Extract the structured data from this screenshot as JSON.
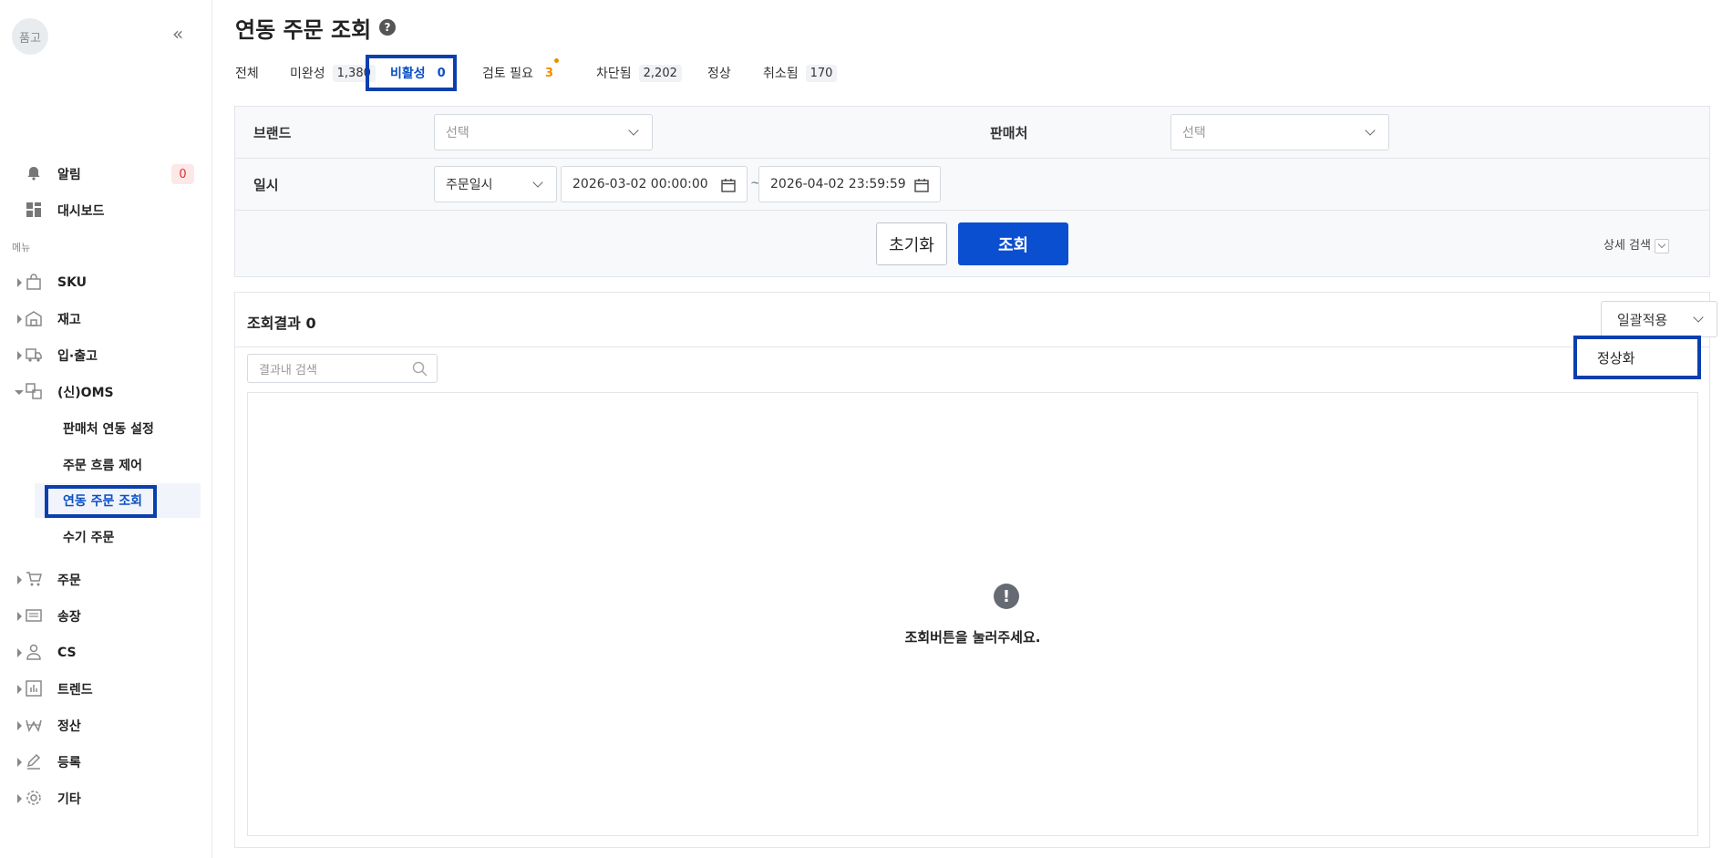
{
  "sidebar": {
    "avatar_text": "품고",
    "collapse_icon": "«",
    "alerts": {
      "label": "알림",
      "count": "0"
    },
    "dashboard": {
      "label": "대시보드"
    },
    "menu_section": "메뉴",
    "items": [
      {
        "label": "SKU",
        "icon": "bag-icon"
      },
      {
        "label": "재고",
        "icon": "warehouse-icon"
      },
      {
        "label": "입·출고",
        "icon": "truck-icon"
      },
      {
        "label": "(신)OMS",
        "icon": "sync-icon"
      },
      {
        "label": "주문",
        "icon": "cart-icon"
      },
      {
        "label": "송장",
        "icon": "invoice-icon"
      },
      {
        "label": "CS",
        "icon": "person-icon"
      },
      {
        "label": "트렌드",
        "icon": "chart-icon"
      },
      {
        "label": "정산",
        "icon": "won-icon"
      },
      {
        "label": "등록",
        "icon": "pencil-icon"
      },
      {
        "label": "기타",
        "icon": "gear-icon"
      }
    ],
    "oms_subitems": [
      {
        "label": "판매처 연동 설정"
      },
      {
        "label": "주문 흐름 제어"
      },
      {
        "label": "연동 주문 조회",
        "active": true
      },
      {
        "label": "수기 주문"
      }
    ]
  },
  "page": {
    "title": "연동 주문 조회",
    "help_icon": "?"
  },
  "tabs": [
    {
      "label": "전체",
      "count": ""
    },
    {
      "label": "미완성",
      "count": "1,380"
    },
    {
      "label": "비활성",
      "count": "0",
      "active": true
    },
    {
      "label": "검토 필요",
      "count": "3"
    },
    {
      "label": "차단됨",
      "count": "2,202"
    },
    {
      "label": "정상",
      "count": ""
    },
    {
      "label": "취소됨",
      "count": "170"
    }
  ],
  "filters": {
    "brand_label": "브랜드",
    "brand_placeholder": "선택",
    "seller_label": "판매처",
    "seller_placeholder": "선택",
    "datetime_label": "일시",
    "date_type": "주문일시",
    "date_from": "2026-03-02 00:00:00",
    "date_sep": "~",
    "date_to": "2026-04-02 23:59:59",
    "reset_label": "초기화",
    "search_label": "조회",
    "detail_search_label": "상세 검색"
  },
  "results": {
    "title": "조회결과 0",
    "bulk_label": "일괄적용",
    "bulk_option": "정상화",
    "search_placeholder": "결과내 검색",
    "empty_message": "조회버튼을 눌러주세요.",
    "empty_icon": "!"
  },
  "colors": {
    "primary": "#0b4fd1",
    "highlight": "#0b3fae",
    "warning": "#f08c00",
    "danger": "#e03131"
  }
}
